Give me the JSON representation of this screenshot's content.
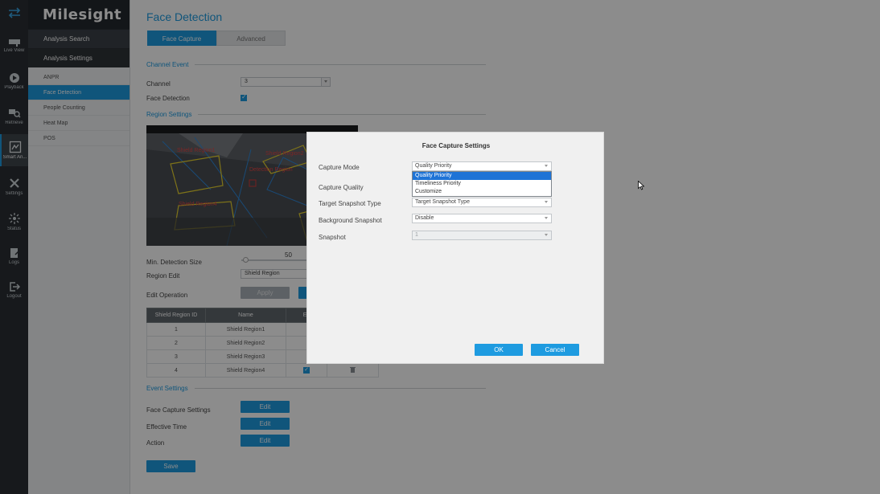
{
  "rail": [
    {
      "label": "",
      "icon": "switch-arrows-icon"
    },
    {
      "label": "Live View",
      "icon": "camera-icon"
    },
    {
      "label": "Playback",
      "icon": "playback-icon"
    },
    {
      "label": "Retrieve",
      "icon": "retrieve-icon"
    },
    {
      "label": "Smart An...",
      "icon": "smart-analysis-icon"
    },
    {
      "label": "Settings",
      "icon": "settings-icon"
    },
    {
      "label": "Status",
      "icon": "status-icon"
    },
    {
      "label": "Logs",
      "icon": "logs-icon"
    },
    {
      "label": "Logout",
      "icon": "logout-icon"
    }
  ],
  "brand": "Milesight",
  "sidebar": {
    "analysis_search": "Analysis Search",
    "analysis_settings": "Analysis Settings",
    "items": [
      "ANPR",
      "Face Detection",
      "People Counting",
      "Heat Map",
      "POS"
    ]
  },
  "main": {
    "title": "Face Detection",
    "tabs": [
      "Face Capture",
      "Advanced"
    ],
    "channel_event_section": "Channel Event",
    "channel_label": "Channel",
    "channel_value": "3",
    "face_detection_label": "Face Detection",
    "region_settings_section": "Region Settings",
    "video_labels": [
      "Shield Region1",
      "Shield Region2",
      "Detection Region",
      "Shield Region4"
    ],
    "min_detection_size_label": "Min. Detection Size",
    "min_detection_size_value": "50",
    "region_edit_label": "Region Edit",
    "region_edit_value": "Shield Region",
    "edit_operation_label": "Edit Operation",
    "apply_button": "Apply",
    "table": {
      "headers": [
        "Shield Region ID",
        "Name",
        "En"
      ],
      "rows": [
        [
          "1",
          "Shield Region1"
        ],
        [
          "2",
          "Shield Region2"
        ],
        [
          "3",
          "Shield Region3"
        ],
        [
          "4",
          "Shield Region4"
        ]
      ]
    },
    "event_settings_section": "Event Settings",
    "face_capture_settings_label": "Face Capture Settings",
    "effective_time_label": "Effective Time",
    "action_label": "Action",
    "edit_button": "Edit",
    "save_button": "Save"
  },
  "modal": {
    "title": "Face Capture Settings",
    "capture_mode_label": "Capture Mode",
    "capture_mode_value": "Quality Priority",
    "capture_mode_options": [
      "Quality Priority",
      "Timeliness Priority",
      "Customize"
    ],
    "capture_quality_label": "Capture Quality",
    "target_snapshot_type_label": "Target Snapshot Type",
    "target_snapshot_type_value": "Target Snapshot Type",
    "background_snapshot_label": "Background Snapshot",
    "background_snapshot_value": "Disable",
    "snapshot_label": "Snapshot",
    "snapshot_value": "1",
    "ok_button": "OK",
    "cancel_button": "Cancel"
  },
  "colors": {
    "accent": "#1e9be0",
    "rail_bg": "#2a2f34",
    "dropdown_highlight": "#1e73d6"
  }
}
